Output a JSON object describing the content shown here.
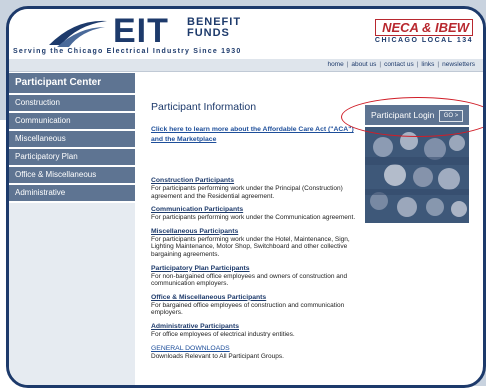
{
  "header": {
    "logo_text": "EIT",
    "logo_sub_line1": "BENEFIT",
    "logo_sub_line2": "FUNDS",
    "tagline": "Serving the Chicago Electrical Industry Since 1930",
    "partner_mark": "NECA & IBEW",
    "partner_sub": "CHICAGO  LOCAL 134"
  },
  "nav": {
    "links": [
      "home",
      "about us",
      "contact us",
      "links",
      "newsletters"
    ]
  },
  "sidebar": {
    "header": "Participant Center",
    "items": [
      "Construction",
      "Communication",
      "Miscellaneous",
      "Participatory Plan",
      "Office & Miscellaneous",
      "Administrative"
    ]
  },
  "main": {
    "title": "Participant Information",
    "aca_link": "Click here to learn more about the Affordable Care Act (\"ACA\") and the Marketplace",
    "sections": [
      {
        "title": "Construction Participants",
        "desc": "For participants performing work under the Principal (Construction) agreement and the Residential agreement."
      },
      {
        "title": "Communication Participants",
        "desc": "For participants performing work under the Communication agreement."
      },
      {
        "title": "Miscellaneous Participants",
        "desc": "For participants performing work under the Hotel, Maintenance, Sign, Lighting Maintenance, Motor Shop, Switchboard and other collective bargaining agreements."
      },
      {
        "title": "Participatory Plan Participants",
        "desc": "For non-bargained office employees and owners of construction and communication employers."
      },
      {
        "title": "Office & Miscellaneous Participants",
        "desc": "For bargained office employees of construction and communication employers."
      },
      {
        "title": "Administrative Participants",
        "desc": "For office employees of electrical industry entities."
      }
    ],
    "downloads": {
      "title": "GENERAL DOWNLOADS",
      "desc": "Downloads Relevant to All Participant Groups."
    }
  },
  "login": {
    "label": "Participant Login",
    "go": "GO >"
  },
  "colors": {
    "brand_navy": "#1d3a6b",
    "sidebar_blue": "#5e7492",
    "highlight_red": "#d01e28"
  }
}
